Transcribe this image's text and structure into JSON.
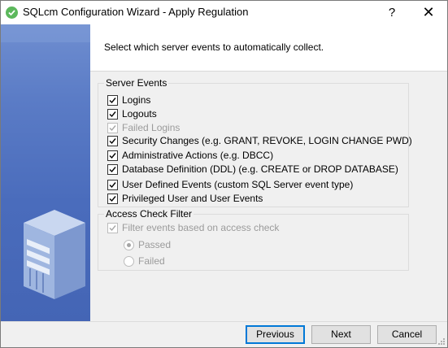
{
  "window": {
    "title": "SQLcm Configuration Wizard - Apply Regulation",
    "help_glyph": "?",
    "close_glyph": "✕"
  },
  "header": {
    "instruction": "Select which server events to automatically collect."
  },
  "server_events": {
    "label": "Server Events",
    "items": [
      {
        "label": "Logins",
        "checked": true,
        "enabled": true
      },
      {
        "label": "Logouts",
        "checked": true,
        "enabled": true
      },
      {
        "label": "Failed Logins",
        "checked": true,
        "enabled": false
      },
      {
        "label": "Security Changes (e.g.  GRANT, REVOKE, LOGIN CHANGE PWD)",
        "checked": true,
        "enabled": true
      },
      {
        "label": "Administrative Actions (e.g. DBCC)",
        "checked": true,
        "enabled": true
      },
      {
        "label": "Database Definition (DDL) (e.g.  CREATE or DROP DATABASE)",
        "checked": true,
        "enabled": true
      },
      {
        "label": "User Defined Events (custom SQL Server event type)",
        "checked": true,
        "enabled": true
      },
      {
        "label": "Privileged User and User Events",
        "checked": true,
        "enabled": true
      }
    ]
  },
  "access_check": {
    "label": "Access Check Filter",
    "filter_label": "Filter events based on access check",
    "filter_checked": true,
    "options": [
      {
        "label": "Passed",
        "selected": true
      },
      {
        "label": "Failed",
        "selected": false
      }
    ]
  },
  "buttons": {
    "previous": "Previous",
    "next": "Next",
    "cancel": "Cancel"
  },
  "colors": {
    "accent": "#0078d7",
    "side_panel": "#4a6cbc",
    "title_icon": "#5cb85c"
  }
}
